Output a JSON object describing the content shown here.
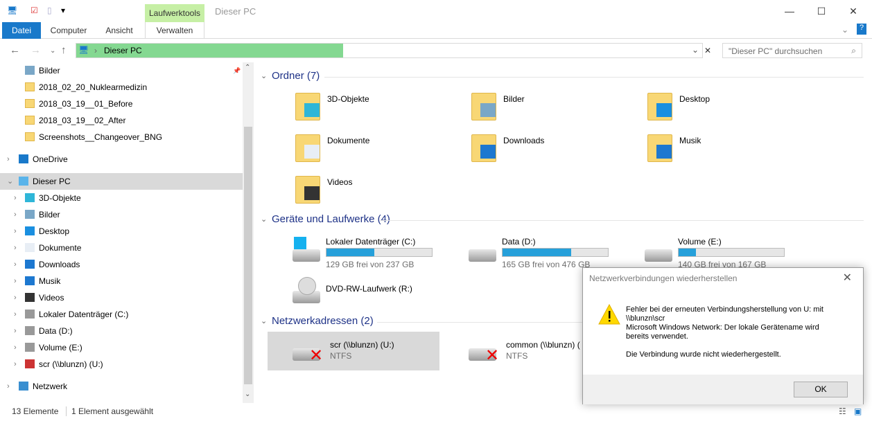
{
  "window": {
    "title": "Dieser PC",
    "context_tab": "Laufwerktools"
  },
  "ribbon": {
    "tabs": [
      "Datei",
      "Computer",
      "Ansicht",
      "Verwalten"
    ]
  },
  "address": {
    "path": "Dieser PC",
    "search_placeholder": "\"Dieser PC\" durchsuchen"
  },
  "colors": {
    "accent": "#1979ca",
    "context": "#c6efa5",
    "address_progress": "#84d891",
    "drive_bar": "#26a0da",
    "selected": "#d9d9d9"
  },
  "nav": {
    "items": [
      {
        "label": "Bilder",
        "icon": "pictures-icon",
        "indent": 1,
        "pin": true
      },
      {
        "label": "2018_02_20_Nuklearmedizin",
        "icon": "folder-icon",
        "indent": 1
      },
      {
        "label": "2018_03_19__01_Before",
        "icon": "folder-icon",
        "indent": 1
      },
      {
        "label": "2018_03_19__02_After",
        "icon": "folder-icon",
        "indent": 1
      },
      {
        "label": "Screenshots__Changeover_BNG",
        "icon": "folder-icon",
        "indent": 1
      },
      {
        "label": "OneDrive",
        "icon": "cloud-icon",
        "indent": 0,
        "chev": ">"
      },
      {
        "label": "Dieser PC",
        "icon": "computer-icon",
        "indent": 0,
        "chev": "v",
        "selected": true
      },
      {
        "label": "3D-Objekte",
        "icon": "cube-icon",
        "indent": 1,
        "chev": ">"
      },
      {
        "label": "Bilder",
        "icon": "pictures-icon",
        "indent": 1,
        "chev": ">"
      },
      {
        "label": "Desktop",
        "icon": "desktop-icon",
        "indent": 1,
        "chev": ">"
      },
      {
        "label": "Dokumente",
        "icon": "document-icon",
        "indent": 1,
        "chev": ">"
      },
      {
        "label": "Downloads",
        "icon": "download-icon",
        "indent": 1,
        "chev": ">"
      },
      {
        "label": "Musik",
        "icon": "music-icon",
        "indent": 1,
        "chev": ">"
      },
      {
        "label": "Videos",
        "icon": "video-icon",
        "indent": 1,
        "chev": ">"
      },
      {
        "label": "Lokaler Datenträger (C:)",
        "icon": "drive-icon",
        "indent": 1,
        "chev": ">"
      },
      {
        "label": "Data (D:)",
        "icon": "drive-icon",
        "indent": 1,
        "chev": ">"
      },
      {
        "label": "Volume (E:)",
        "icon": "drive-icon",
        "indent": 1,
        "chev": ">"
      },
      {
        "label": "scr (\\\\blunzn) (U:)",
        "icon": "network-drive-error-icon",
        "indent": 1,
        "chev": ">"
      },
      {
        "label": "Netzwerk",
        "icon": "network-icon",
        "indent": 0,
        "chev": ">"
      }
    ]
  },
  "groups": {
    "folders": {
      "title": "Ordner (7)",
      "items": [
        {
          "label": "3D-Objekte",
          "icon": "cube-icon"
        },
        {
          "label": "Bilder",
          "icon": "pictures-icon"
        },
        {
          "label": "Desktop",
          "icon": "desktop-icon"
        },
        {
          "label": "Dokumente",
          "icon": "document-icon"
        },
        {
          "label": "Downloads",
          "icon": "download-icon"
        },
        {
          "label": "Musik",
          "icon": "music-icon"
        },
        {
          "label": "Videos",
          "icon": "video-icon"
        }
      ]
    },
    "drives": {
      "title": "Geräte und Laufwerke (4)",
      "items": [
        {
          "label": "Lokaler Datenträger (C:)",
          "free": "129 GB frei von 237 GB",
          "used_percent": 45.6,
          "icon": "windows-drive-icon"
        },
        {
          "label": "Data (D:)",
          "free": "165 GB frei von 476 GB",
          "used_percent": 65.3,
          "icon": "drive-icon"
        },
        {
          "label": "Volume (E:)",
          "free": "140 GB frei von 167 GB",
          "used_percent": 16.2,
          "icon": "drive-icon"
        },
        {
          "label": "DVD-RW-Laufwerk (R:)",
          "icon": "dvd-drive-icon"
        }
      ]
    },
    "network": {
      "title": "Netzwerkadressen (2)",
      "items": [
        {
          "label": "scr (\\\\blunzn) (U:)",
          "fs": "NTFS",
          "selected": true
        },
        {
          "label": "common (\\\\blunzn) (",
          "fs": "NTFS"
        }
      ]
    }
  },
  "status": {
    "count": "13 Elemente",
    "selection": "1 Element ausgewählt"
  },
  "dialog": {
    "title": "Netzwerkverbindungen wiederherstellen",
    "line1": "Fehler bei der erneuten Verbindungsherstellung von U: mit",
    "line2": "\\\\blunzn\\scr",
    "line3": "Microsoft Windows Network: Der lokale Gerätename wird",
    "line4": "bereits verwendet.",
    "line5": "Die Verbindung wurde nicht wiederhergestellt.",
    "ok": "OK"
  }
}
